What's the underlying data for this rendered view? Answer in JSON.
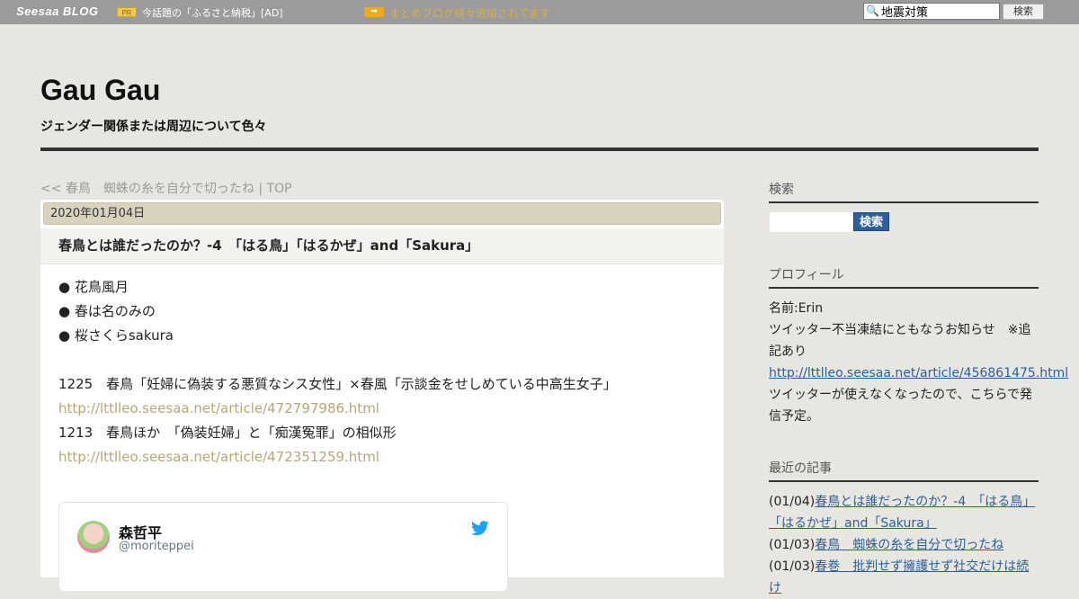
{
  "topbar": {
    "logo": "Seesaa BLOG",
    "pr_badge": "PR",
    "pr_text": "今話題の「ふるさと納税」[AD]",
    "arrow": "➡",
    "notice": "まとめブログ続々追加されてます",
    "search_value": "地震対策",
    "search_button": "検索"
  },
  "header": {
    "title": "Gau Gau",
    "description": "ジェンダー関係または周辺について色々"
  },
  "nav": {
    "prev": "<< 春鳥　蜘蛛の糸を自分で切ったね",
    "separator": " | ",
    "top": "TOP"
  },
  "article": {
    "date": "2020年01月04日",
    "title": "春鳥とは誰だったのか？-4　「はる鳥」「はるかぜ」and「Sakura」",
    "bullets": [
      "● 花鳥風月",
      "● 春は名のみの",
      "● 桜さくらsakura"
    ],
    "entries": [
      {
        "text": "1225　春鳥「妊婦に偽装する悪質なシス女性」×春風「示談金をせしめている中高生女子」",
        "link": "http://lttlleo.seesaa.net/article/472797986.html"
      },
      {
        "text": "1213　春鳥ほか　「偽装妊婦」と「痴漢冤罪」の相似形",
        "link": "http://lttlleo.seesaa.net/article/472351259.html"
      }
    ],
    "tweet": {
      "name": "森哲平",
      "handle": "@moriteppei"
    }
  },
  "sidebar": {
    "search_heading": "検索",
    "search_button": "検索",
    "profile_heading": "プロフィール",
    "profile_name": "名前:Erin",
    "profile_line1": "ツイッター不当凍結にともなうお知らせ　※追",
    "profile_line2": "記あり",
    "profile_link": "http://lttlleo.seesaa.net/article/456861475.html",
    "profile_line3": "ツイッターが使えなくなったので、こちらで発",
    "profile_line4": "信予定。",
    "recent_heading": "最近の記事",
    "recent": [
      {
        "date": "(01/04)",
        "title": "春鳥とは誰だったのか？-4　「はる鳥」"
      },
      {
        "date": "",
        "title": "「はるかぜ」and「Sakura」"
      },
      {
        "date": "(01/03)",
        "title": "春鳥　蜘蛛の糸を自分で切ったね"
      },
      {
        "date": "(01/03)",
        "title": "春巻　批判せず擁護せず社交だけは続け"
      }
    ]
  },
  "colors": {
    "topbar_bg": "#9b9b9b",
    "page_bg": "#e8e6e1",
    "date_bar": "#d8d2bf",
    "link_article": "#b8a679",
    "link_sidebar": "#2b5f99",
    "notice": "#d9b04c"
  }
}
